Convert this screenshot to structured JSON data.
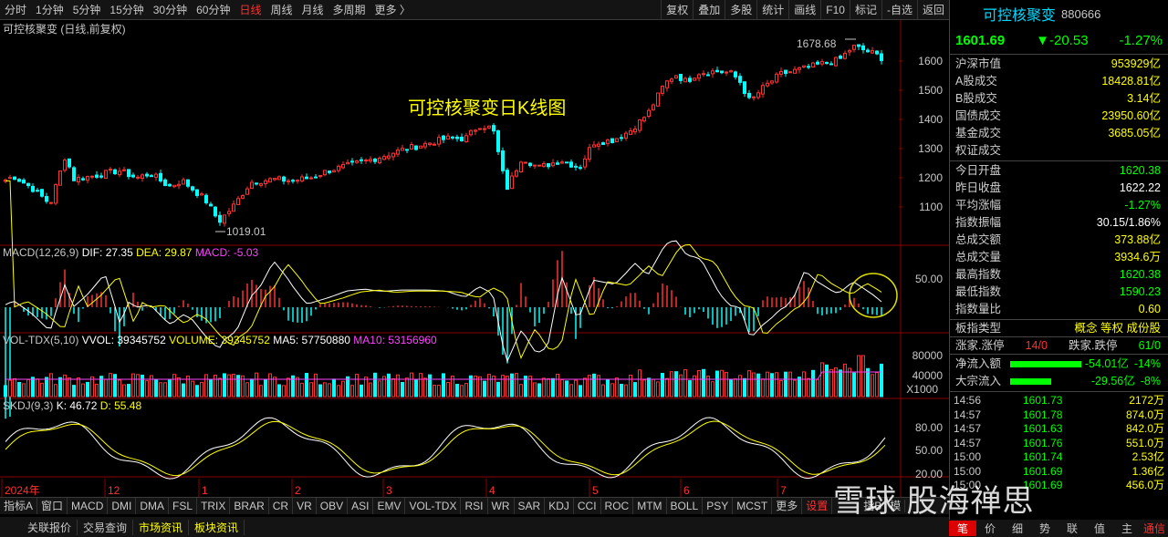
{
  "toolbar": {
    "periods": [
      "分时",
      "1分钟",
      "5分钟",
      "15分钟",
      "30分钟",
      "60分钟",
      "日线",
      "周线",
      "月线",
      "多周期",
      "更多 〉"
    ],
    "active_index": 6,
    "right": [
      "复权",
      "叠加",
      "多股",
      "统计",
      "画线",
      "F10",
      "标记",
      "-自选",
      "返回"
    ]
  },
  "kline": {
    "subtitle": "可控核聚变 (日线,前复权)",
    "annotation": "可控核聚变日K线图",
    "high_label": "1678.68",
    "low_label": "1019.01",
    "axis": [
      "1600",
      "1500",
      "1400",
      "1300",
      "1200",
      "1100"
    ]
  },
  "macd": {
    "name": "MACD(12,26,9)",
    "dif": "DIF: 27.35",
    "dea": "DEA: 29.87",
    "macd": "MACD: -5.03",
    "axis": [
      "50.00"
    ]
  },
  "vol": {
    "name": "VOL-TDX(5,10)",
    "vvol": "VVOL: 39345752",
    "volume": "VOLUME: 39345752",
    "ma5": "MA5: 57750880",
    "ma10": "MA10: 53156960",
    "axis": [
      "80000",
      "40000"
    ],
    "unit": "X1000"
  },
  "skdj": {
    "name": "SKDJ(9,3)",
    "k": "K: 46.72",
    "d": "D: 55.48",
    "axis": [
      "80.00",
      "50.00",
      "20.00"
    ]
  },
  "xaxis": [
    "2024年",
    "12",
    "1",
    "2",
    "3",
    "4",
    "5",
    "6",
    "7"
  ],
  "indicators": [
    "指标A",
    "窗口",
    "MACD",
    "DMI",
    "DMA",
    "FSL",
    "TRIX",
    "BRAR",
    "CR",
    "VR",
    "OBV",
    "ASI",
    "EMV",
    "VOL-TDX",
    "RSI",
    "WR",
    "SAR",
    "KDJ",
    "CCI",
    "ROC",
    "MTM",
    "BOLL",
    "PSY",
    "MCST",
    "更多",
    "设置"
  ],
  "indicator_tail": [
    "指B",
    "模"
  ],
  "bottom_tabs": [
    "关联报价",
    "交易查询",
    "市场资讯",
    "板块资讯"
  ],
  "sidebar": {
    "name": "可控核聚变",
    "code": "880666",
    "price": "1601.69",
    "change": "▼-20.53",
    "pct": "-1.27%",
    "market": [
      {
        "l": "沪深市值",
        "v": "953929亿"
      },
      {
        "l": "A股成交",
        "v": "18428.81亿"
      },
      {
        "l": "B股成交",
        "v": "3.14亿"
      },
      {
        "l": "国债成交",
        "v": "23950.60亿"
      },
      {
        "l": "基金成交",
        "v": "3685.05亿"
      },
      {
        "l": "权证成交",
        "v": ""
      }
    ],
    "stats": [
      {
        "l": "今日开盘",
        "v": "1620.38",
        "c": "g"
      },
      {
        "l": "昨日收盘",
        "v": "1622.22",
        "c": "w"
      },
      {
        "l": "平均涨幅",
        "v": "-1.27%",
        "c": "g"
      },
      {
        "l": "指数振幅",
        "v": "30.15/1.86%",
        "c": "w"
      },
      {
        "l": "总成交额",
        "v": "373.88亿",
        "c": "y"
      },
      {
        "l": "总成交量",
        "v": "3934.6万",
        "c": "y"
      },
      {
        "l": "最高指数",
        "v": "1620.38",
        "c": "g"
      },
      {
        "l": "最低指数",
        "v": "1590.23",
        "c": "g"
      },
      {
        "l": "指数量比",
        "v": "0.60",
        "c": "y"
      }
    ],
    "block_type": {
      "l": "板指类型",
      "v": "概念 等权 成份股"
    },
    "updown": {
      "l1": "涨家.涨停",
      "v1": "14/0",
      "l2": "跌家.跌停",
      "v2": "61/0"
    },
    "flow": [
      {
        "l": "净流入额",
        "v": "-54.01亿",
        "p": "-14%",
        "frac": 0.14
      },
      {
        "l": "大宗流入",
        "v": "-29.56亿",
        "p": "-8%",
        "frac": 0.08
      }
    ],
    "ticks": [
      [
        "14:56",
        "1601.73",
        "2172万"
      ],
      [
        "14:57",
        "1601.78",
        "874.0万"
      ],
      [
        "14:57",
        "1601.63",
        "842.0万"
      ],
      [
        "14:57",
        "1601.76",
        "551.0万"
      ],
      [
        "15:00",
        "1601.74",
        "2.53亿"
      ],
      [
        "15:00",
        "1601.69",
        "1.36亿"
      ],
      [
        "15:00",
        "1601.69",
        "456.0万"
      ]
    ],
    "tabs": [
      "笔",
      "价",
      "细",
      "势",
      "联",
      "值",
      "主",
      "通信"
    ]
  },
  "watermark": "雪球 股海禅思",
  "colors": {
    "up": "#ff3030",
    "down": "#00ffff",
    "dif": "#ffffff",
    "dea": "#ffff00",
    "macd": "#ff44ff"
  }
}
